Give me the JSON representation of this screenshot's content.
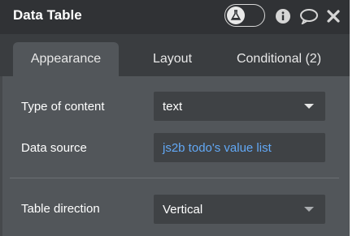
{
  "header": {
    "title": "Data Table",
    "icons": [
      "flask-icon",
      "info-icon",
      "comment-icon",
      "close-icon"
    ]
  },
  "tabs": [
    {
      "label": "Appearance",
      "active": true
    },
    {
      "label": "Layout",
      "active": false
    },
    {
      "label": "Conditional (2)",
      "active": false
    }
  ],
  "fields": {
    "type_of_content": {
      "label": "Type of content",
      "value": "text"
    },
    "data_source": {
      "label": "Data source",
      "value": "js2b todo's value list"
    },
    "table_direction": {
      "label": "Table direction",
      "value": "Vertical"
    }
  },
  "colors": {
    "header_bg": "#303235",
    "panel_bg": "#52565a",
    "link": "#62a8f5"
  }
}
